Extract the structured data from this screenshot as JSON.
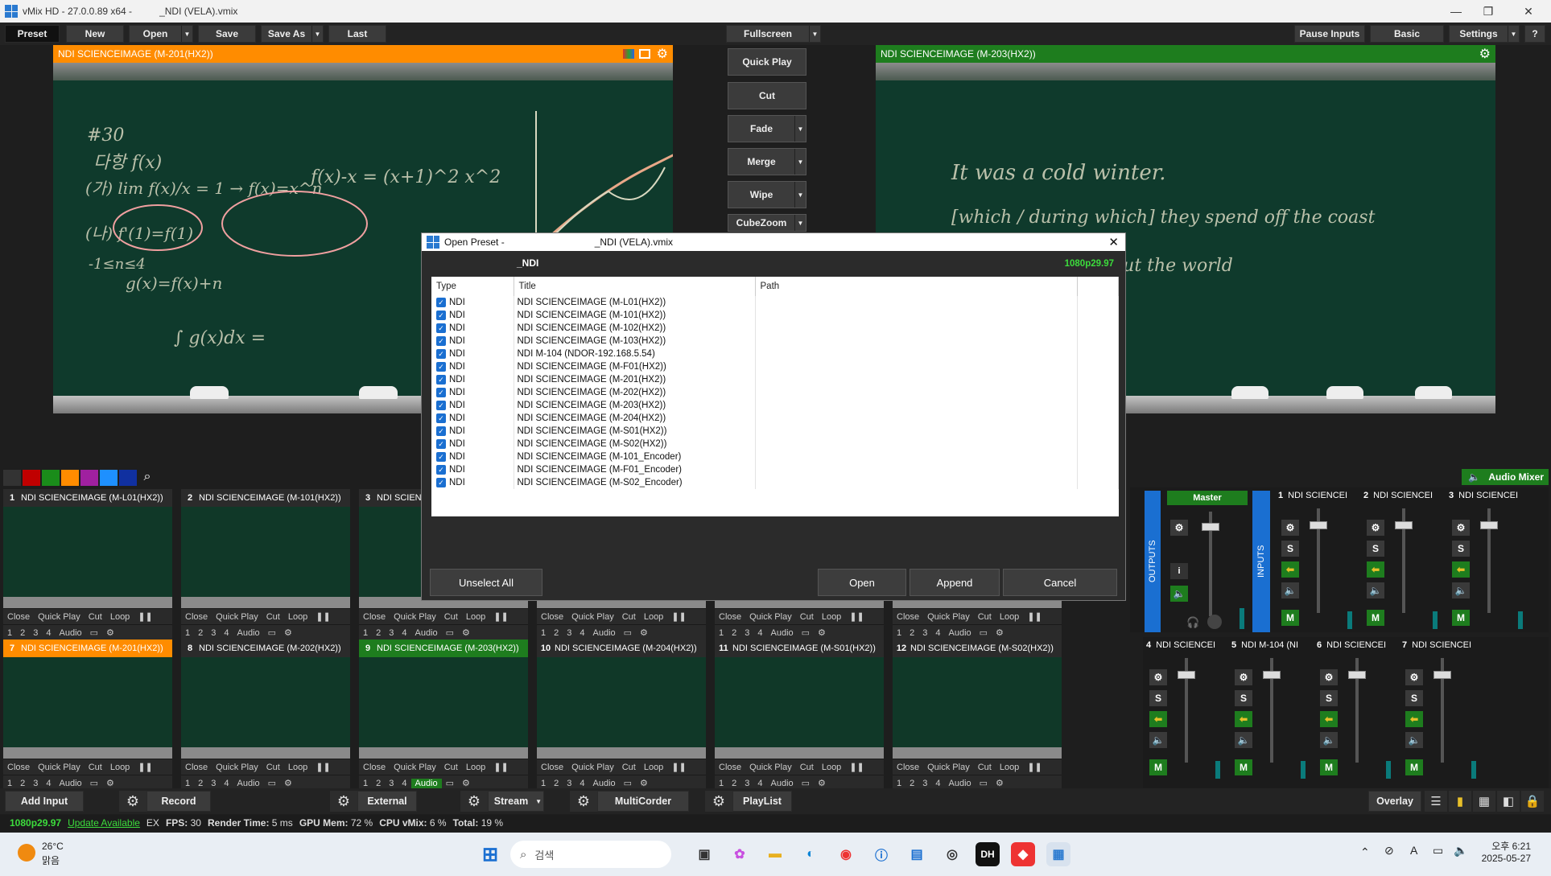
{
  "window": {
    "title": "vMix HD - 27.0.0.89 x64 - ",
    "file_name": "_NDI (VELA).vmix",
    "controls": [
      "—",
      "❐",
      "✕"
    ]
  },
  "toolbar": {
    "preset": "Preset",
    "new": "New",
    "open": "Open",
    "save": "Save",
    "save_as": "Save As",
    "last": "Last",
    "fullscreen": "Fullscreen",
    "pause_inputs": "Pause Inputs",
    "basic": "Basic",
    "settings": "Settings",
    "help": "?"
  },
  "preview": {
    "title": "NDI SCIENCEIMAGE (M-201(HX2))",
    "color": "#ff8c00"
  },
  "output": {
    "title": "NDI SCIENCEIMAGE (M-203(HX2))",
    "color": "#1e7d1e"
  },
  "transitions": [
    "Quick Play",
    "Cut",
    "Fade",
    "Merge",
    "Wipe",
    "CubeZoom"
  ],
  "chalk_left": [
    "#30",
    "다항 f(x)",
    "(가) lim f(x)/x = 1 → f(x)=x^n",
    "f(x)-x = (x+1)^2 x^2",
    "(나) f'(1)=f(1)",
    "g(x)=f(x)+n",
    "-1≤n≤4",
    "∫ g(x)dx ="
  ],
  "chalk_right": [
    "It was a cold winter.",
    "[which / during which] they spend off the coast",
    "how you believe about the world"
  ],
  "color_swatches": [
    "#c00000",
    "#1a8c1a",
    "#ff8c00",
    "#a020a0",
    "#1e90ff",
    "#1030a0"
  ],
  "dialog": {
    "title": "Open Preset - ",
    "file_name": "_NDI (VELA).vmix",
    "name": "_NDI",
    "format": "1080p29.97",
    "columns": [
      "Type",
      "Title",
      "Path"
    ],
    "rows": [
      {
        "type": "NDI",
        "title": "NDI SCIENCEIMAGE (M-L01(HX2))"
      },
      {
        "type": "NDI",
        "title": "NDI SCIENCEIMAGE (M-101(HX2))"
      },
      {
        "type": "NDI",
        "title": "NDI SCIENCEIMAGE (M-102(HX2))"
      },
      {
        "type": "NDI",
        "title": "NDI SCIENCEIMAGE (M-103(HX2))"
      },
      {
        "type": "NDI",
        "title": "NDI M-104 (NDOR-192.168.5.54)"
      },
      {
        "type": "NDI",
        "title": "NDI SCIENCEIMAGE (M-F01(HX2))"
      },
      {
        "type": "NDI",
        "title": "NDI SCIENCEIMAGE (M-201(HX2))"
      },
      {
        "type": "NDI",
        "title": "NDI SCIENCEIMAGE (M-202(HX2))"
      },
      {
        "type": "NDI",
        "title": "NDI SCIENCEIMAGE (M-203(HX2))"
      },
      {
        "type": "NDI",
        "title": "NDI SCIENCEIMAGE (M-204(HX2))"
      },
      {
        "type": "NDI",
        "title": "NDI SCIENCEIMAGE (M-S01(HX2))"
      },
      {
        "type": "NDI",
        "title": "NDI SCIENCEIMAGE (M-S02(HX2))"
      },
      {
        "type": "NDI",
        "title": "NDI SCIENCEIMAGE (M-101_Encoder)"
      },
      {
        "type": "NDI",
        "title": "NDI SCIENCEIMAGE (M-F01_Encoder)"
      },
      {
        "type": "NDI",
        "title": "NDI SCIENCEIMAGE (M-S02_Encoder)"
      }
    ],
    "buttons": {
      "unselect_all": "Unselect All",
      "open": "Open",
      "append": "Append",
      "cancel": "Cancel"
    }
  },
  "input_controls": {
    "close": "Close",
    "quick_play": "Quick Play",
    "cut": "Cut",
    "loop": "Loop",
    "pause": "❚❚",
    "n1": "1",
    "n2": "2",
    "n3": "3",
    "n4": "4",
    "audio": "Audio"
  },
  "inputs_row1": [
    {
      "num": "1",
      "title": "NDI SCIENCEIMAGE (M-L01(HX2))"
    },
    {
      "num": "2",
      "title": "NDI SCIENCEIMAGE (M-101(HX2))"
    },
    {
      "num": "3",
      "title": "NDI SCIENCEIMAGE (M-102(HX2))"
    },
    {
      "num": "",
      "title": ""
    },
    {
      "num": "",
      "title": ""
    },
    {
      "num": "",
      "title": ""
    }
  ],
  "inputs_row2": [
    {
      "num": "7",
      "title": "NDI SCIENCEIMAGE (M-201(HX2))",
      "state": "preview"
    },
    {
      "num": "8",
      "title": "NDI SCIENCEIMAGE (M-202(HX2))",
      "state": ""
    },
    {
      "num": "9",
      "title": "NDI SCIENCEIMAGE (M-203(HX2))",
      "state": "active"
    },
    {
      "num": "10",
      "title": "NDI SCIENCEIMAGE (M-204(HX2))",
      "state": ""
    },
    {
      "num": "11",
      "title": "NDI SCIENCEIMAGE (M-S01(HX2))",
      "state": ""
    },
    {
      "num": "12",
      "title": "NDI SCIENCEIMAGE (M-S02(HX2))",
      "state": ""
    }
  ],
  "audio_mixer": {
    "label": "Audio Mixer",
    "master": "Master",
    "outputs": "OUTPUTS",
    "inputs": "INPUTS",
    "top_channels": [
      {
        "num": "1",
        "name": "NDI SCIENCEI"
      },
      {
        "num": "2",
        "name": "NDI SCIENCEI"
      },
      {
        "num": "3",
        "name": "NDI SCIENCEI"
      }
    ],
    "bottom_channels": [
      {
        "num": "4",
        "name": "NDI SCIENCEI"
      },
      {
        "num": "5",
        "name": "NDI M-104 (NI"
      },
      {
        "num": "6",
        "name": "NDI SCIENCEI"
      },
      {
        "num": "7",
        "name": "NDI SCIENCEI"
      }
    ],
    "solo": "S",
    "mute": "M",
    "info": "i"
  },
  "bottom_toolbar": {
    "add_input": "Add Input",
    "record": "Record",
    "external": "External",
    "stream": "Stream",
    "multicorder": "MultiCorder",
    "playlist": "PlayList",
    "overlay": "Overlay"
  },
  "status": {
    "format": "1080p29.97",
    "update": "Update Available",
    "ex": "EX",
    "fps_label": "FPS:",
    "fps": "30",
    "render_label": "Render Time:",
    "render": "5 ms",
    "gpu_label": "GPU Mem:",
    "gpu": "72 %",
    "cpu_label": "CPU vMix:",
    "cpu": "6 %",
    "total_label": "Total:",
    "total": "19 %"
  },
  "taskbar": {
    "temp": "26°C",
    "weather": "맑음",
    "search_placeholder": "검색",
    "time": "오후 6:21",
    "date": "2025-05-27",
    "lang": "A",
    "dh": "DH"
  }
}
